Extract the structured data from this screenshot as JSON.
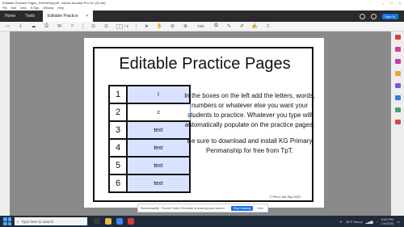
{
  "window": {
    "title": "Editable Practice Pages_FimtheSky.pdf - Adobe Acrobat Pro DC (32-bit)",
    "controls": [
      "–",
      "□",
      "×"
    ]
  },
  "menu": [
    "File",
    "Edit",
    "View",
    "E-Sign",
    "Window",
    "Help"
  ],
  "tabs": {
    "home": "Home",
    "tools": "Tools",
    "doc": "Editable Practice Pa...",
    "doc_close": "×",
    "signin": "Sign In"
  },
  "toolbar": {
    "page_current": "1",
    "page_total": "/ 2",
    "zoom": "73%"
  },
  "page": {
    "heading": "Editable Practice Pages",
    "rows": [
      {
        "num": "1",
        "value": "I"
      },
      {
        "num": "2",
        "value": "c"
      },
      {
        "num": "3",
        "value": "text"
      },
      {
        "num": "4",
        "value": "text"
      },
      {
        "num": "5",
        "value": "text"
      },
      {
        "num": "6",
        "value": "text"
      }
    ],
    "instructions_1": "In the boxes on the left add the letters, words, numbers or whatever else you want your students to practice. Whatever you type will automatically populate on the practice pages.",
    "instructions_2": "Be sure to download and install KG Primary Penmanship for free from TpT.",
    "copyright": "© Pie in the Sky 2022"
  },
  "sharebar": {
    "message": "Screencastify - Screen Video Recorder is sharing your screen.",
    "stop": "Stop sharing",
    "hide": "Hide"
  },
  "taskbar": {
    "search_placeholder": "Type here to search",
    "weather": "16°F  Sunny",
    "time": "8:40 PM",
    "date": "1/4/2022"
  }
}
